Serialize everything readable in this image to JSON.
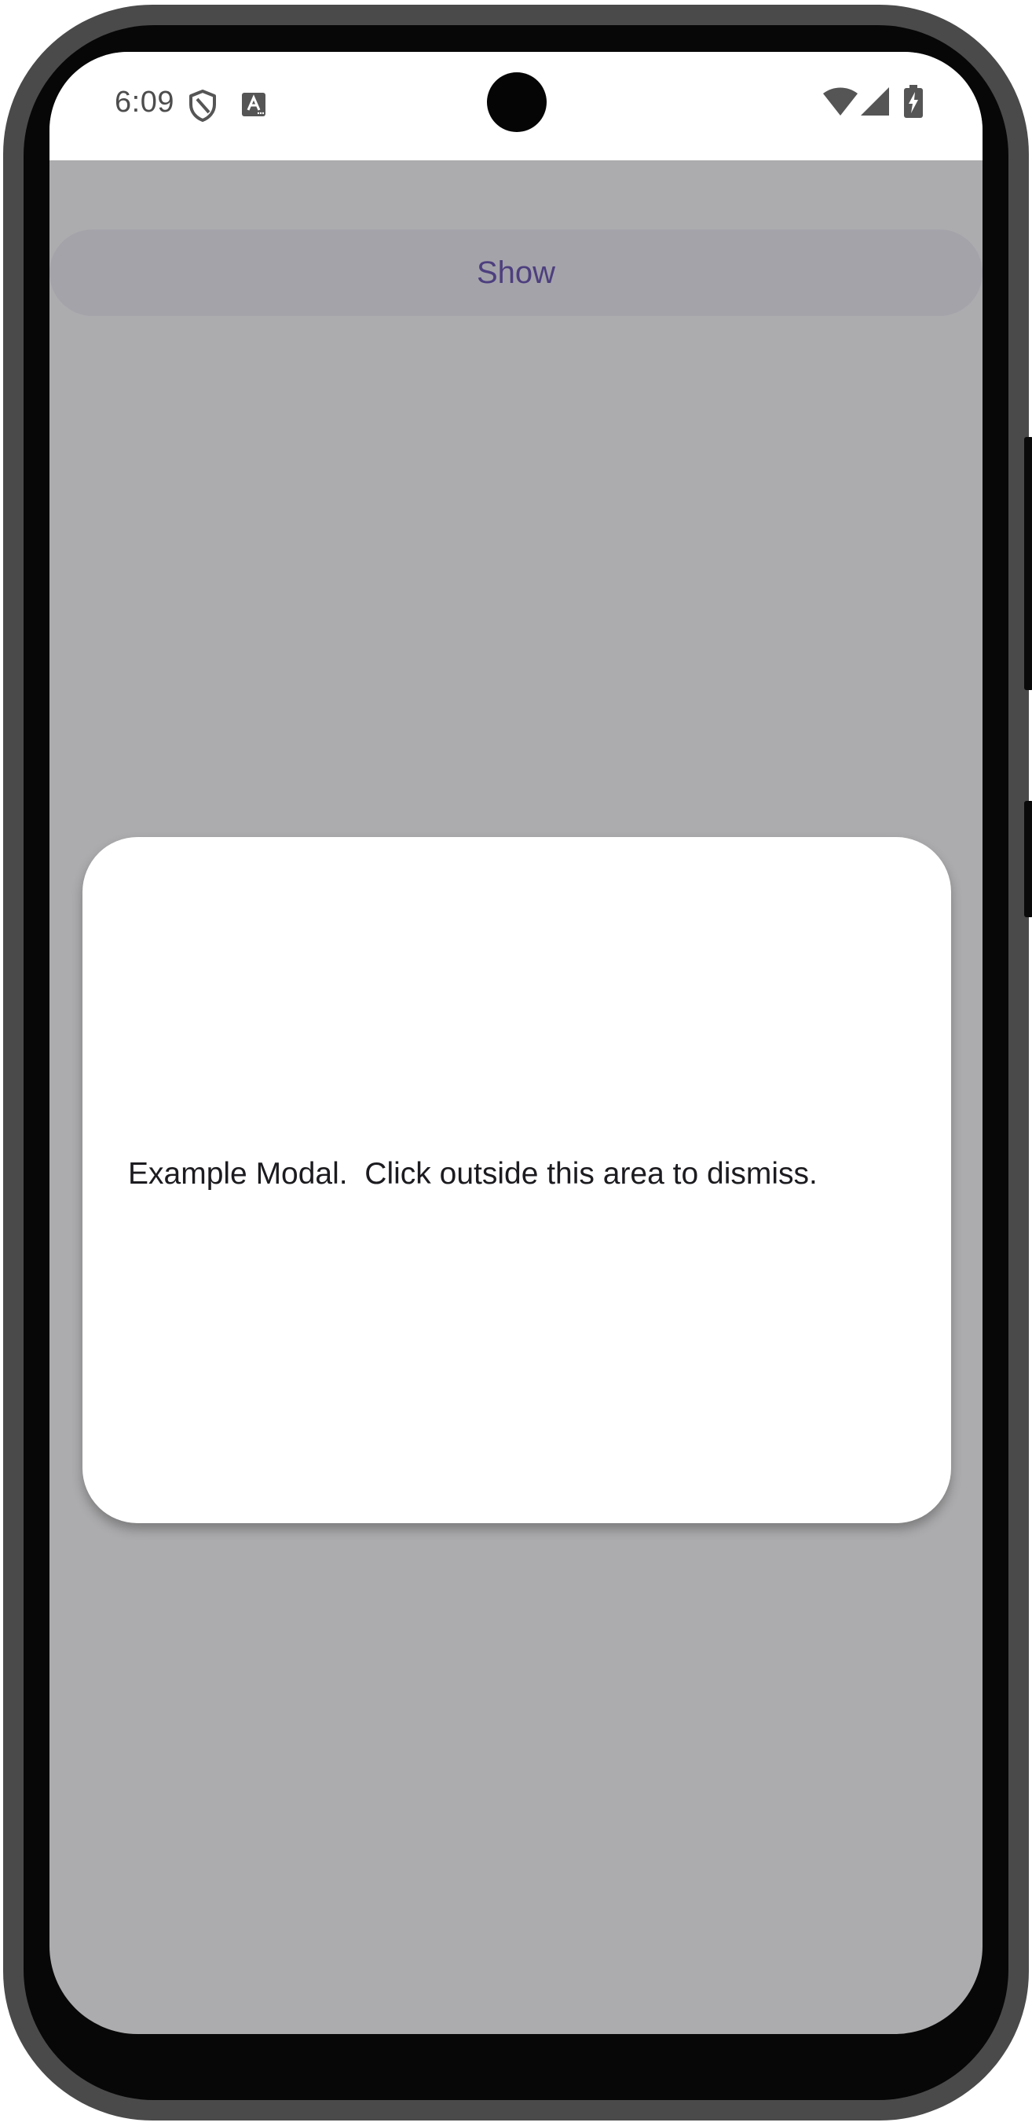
{
  "status_bar": {
    "time": "6:09",
    "icons": [
      "shield-icon",
      "font-a-icon",
      "wifi-icon",
      "signal-icon",
      "battery-charging-icon"
    ]
  },
  "main": {
    "show_button_label": "Show"
  },
  "modal": {
    "message": "Example Modal.  Click outside this area to dismiss."
  },
  "colors": {
    "scrim": "#acacae",
    "button_bg": "#a4a3aa",
    "button_text": "#4d3f7e",
    "modal_bg": "#ffffff",
    "frame": "#4a4a4a"
  }
}
